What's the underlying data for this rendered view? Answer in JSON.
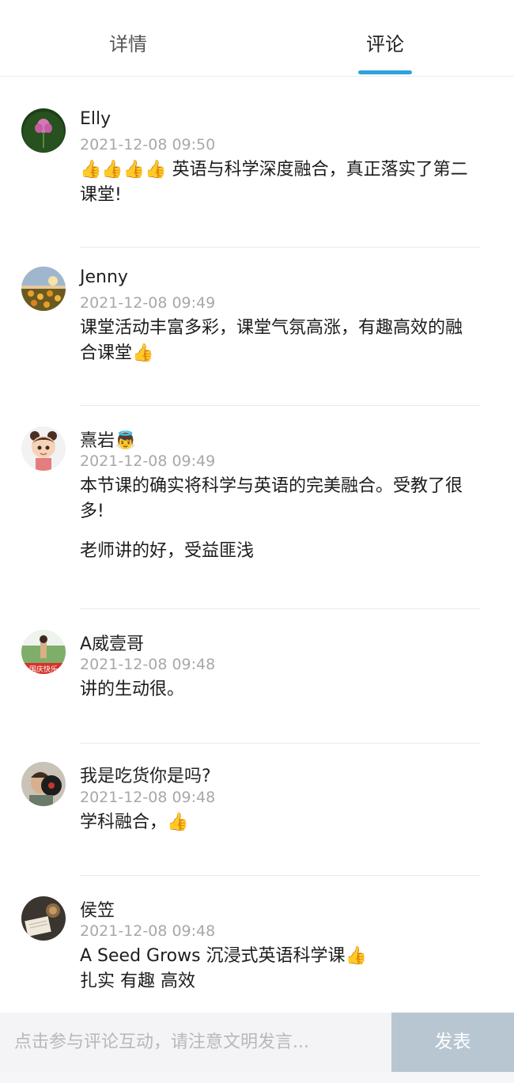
{
  "tabs": [
    {
      "label": "详情",
      "active": false
    },
    {
      "label": "评论",
      "active": true
    }
  ],
  "accent_color": "#2ea3dd",
  "comments": [
    {
      "name": "Elly",
      "time": "2021-12-08 09:50",
      "avatar_icon": "lotus-avatar-icon",
      "text": [
        "👍👍👍👍 英语与科学深度融合，真正落实了第二课堂!"
      ]
    },
    {
      "name": "Jenny",
      "time": "2021-12-08 09:49",
      "avatar_icon": "flowers-sunset-avatar-icon",
      "text": [
        "课堂活动丰富多彩，课堂气氛高涨，有趣高效的融合课堂👍"
      ]
    },
    {
      "name": "熹岩👼",
      "time": "2021-12-08 09:49",
      "avatar_icon": "cartoon-girl-avatar-icon",
      "text": [
        "本节课的确实将科学与英语的完美融合。受教了很多!",
        "老师讲的好，受益匪浅"
      ]
    },
    {
      "name": "A威壹哥",
      "time": "2021-12-08 09:48",
      "avatar_icon": "person-outdoor-avatar-icon",
      "text": [
        "讲的生动很。"
      ]
    },
    {
      "name": "我是吃货你是吗?",
      "time": "2021-12-08 09:48",
      "avatar_icon": "person-record-avatar-icon",
      "text": [
        "学科融合，👍"
      ]
    },
    {
      "name": "侯笠",
      "time": "2021-12-08 09:48",
      "avatar_icon": "book-avatar-icon",
      "text": [
        "A Seed Grows 沉浸式英语科学课👍",
        "扎实 有趣 高效"
      ]
    }
  ],
  "footer": {
    "input_placeholder": "点击参与评论互动，请注意文明发言...",
    "send_label": "发表"
  }
}
